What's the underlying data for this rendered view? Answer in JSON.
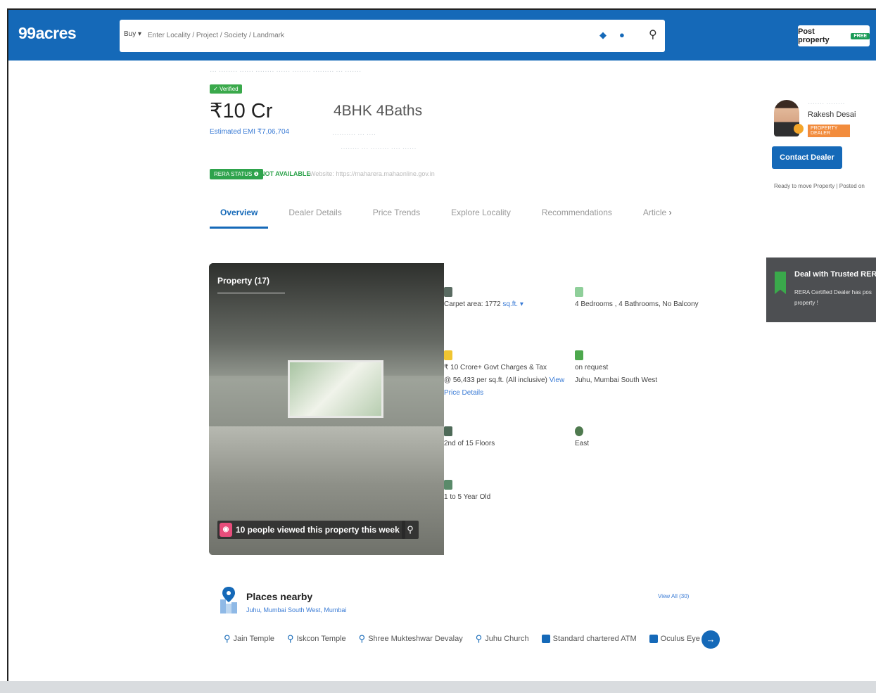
{
  "header": {
    "logo": "99acres",
    "search_mode": "Buy",
    "search_placeholder": "Enter Locality / Project / Society / Landmark",
    "post_property": "Post property",
    "post_badge": "FREE"
  },
  "listing": {
    "verified": "Verified",
    "price": "₹10 Cr",
    "configuration": "4BHK 4Baths",
    "emi": "Estimated EMI ₹7,06,704",
    "rera_status": "RERA STATUS",
    "rera_value": "NOT AVAILABLE",
    "rera_website": "Website: https://maharera.mahaonline.gov.in"
  },
  "tabs": [
    {
      "label": "Overview",
      "active": true
    },
    {
      "label": "Dealer Details",
      "active": false
    },
    {
      "label": "Price Trends",
      "active": false
    },
    {
      "label": "Explore Locality",
      "active": false
    },
    {
      "label": "Recommendations",
      "active": false
    },
    {
      "label": "Article",
      "active": false
    }
  ],
  "gallery": {
    "title": "Property (17)",
    "viewed_text": "10 people viewed this property this week"
  },
  "details": {
    "area": "Carpet area: 1772",
    "area_unit": "sq.ft.",
    "configuration": "4 Bedrooms , 4 Bathrooms, No Balcony",
    "price_line1": "₹ 10 Crore+ Govt Charges & Tax",
    "price_line2": "@ 56,433 per sq.ft. (All inclusive)",
    "price_link": "View Price Details",
    "address_line1": "on request",
    "address_line2": "Juhu, Mumbai South West",
    "floor": "2nd of 15 Floors",
    "facing": "East",
    "age": "1 to 5 Year Old"
  },
  "agent": {
    "name": "Rakesh Desai",
    "tag": "PROPERTY DEALER",
    "contact_button": "Contact Dealer",
    "ready": "Ready to move Property  |  Posted on"
  },
  "rera_card": {
    "title": "Deal with Trusted RERA P",
    "line1": "RERA Certified Dealer has pos",
    "line2": "property !"
  },
  "places": {
    "title": "Places nearby",
    "subtitle": "Juhu, Mumbai South West, Mumbai",
    "view_all": "View All (30)",
    "items": [
      "Jain Temple",
      "Iskcon Temple",
      "Shree Mukteshwar Devalay",
      "Juhu Church",
      "Standard chartered ATM",
      "Oculus Eye"
    ]
  }
}
